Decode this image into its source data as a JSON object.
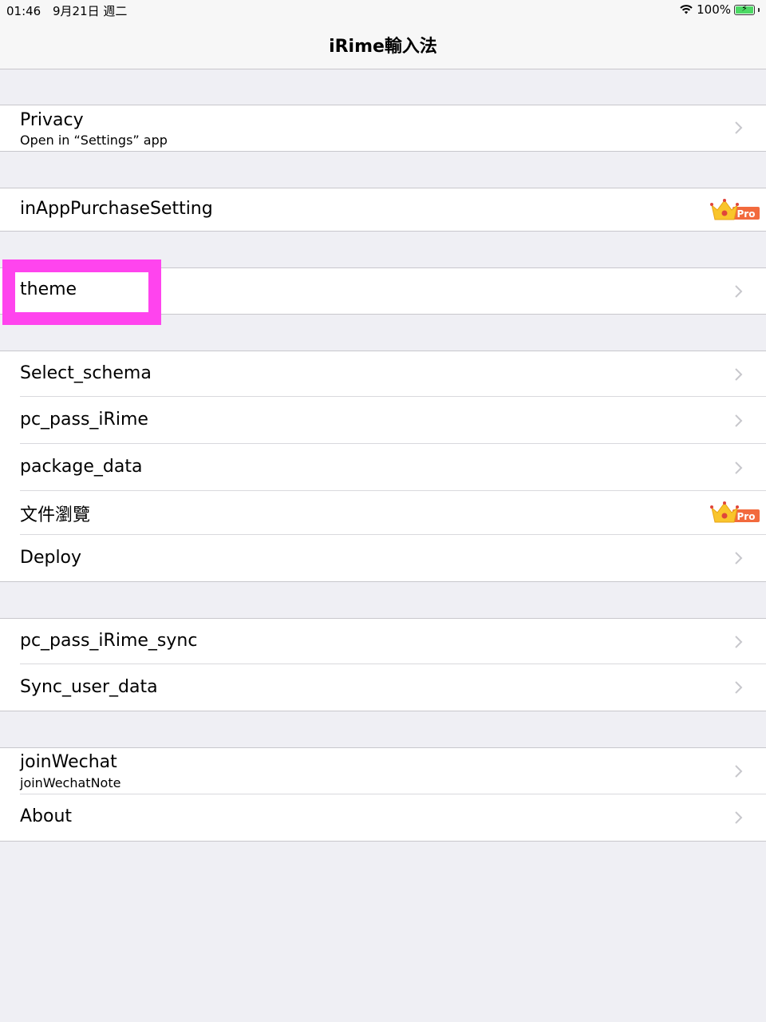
{
  "status_bar": {
    "time": "01:46",
    "date": "9月21日 週二",
    "battery_percent": "100%",
    "battery_level": 1.0
  },
  "nav": {
    "title": "iRime輸入法"
  },
  "badges": {
    "pro_label": "Pro"
  },
  "sections": [
    {
      "items": [
        {
          "title": "Privacy",
          "subtitle": "Open in “Settings” app",
          "accessory": "chevron"
        }
      ]
    },
    {
      "items": [
        {
          "title": "inAppPurchaseSetting",
          "accessory": "pro-badge"
        }
      ]
    },
    {
      "items": [
        {
          "title": "theme",
          "accessory": "chevron",
          "highlighted": true
        }
      ]
    },
    {
      "items": [
        {
          "title": "Select_schema",
          "accessory": "chevron"
        },
        {
          "title": "pc_pass_iRime",
          "accessory": "chevron"
        },
        {
          "title": "package_data",
          "accessory": "chevron"
        },
        {
          "title": "文件瀏覽",
          "accessory": "pro-badge"
        },
        {
          "title": "Deploy",
          "accessory": "chevron"
        }
      ]
    },
    {
      "items": [
        {
          "title": "pc_pass_iRime_sync",
          "accessory": "chevron"
        },
        {
          "title": "Sync_user_data",
          "accessory": "chevron"
        }
      ]
    },
    {
      "items": [
        {
          "title": "joinWechat",
          "subtitle": "joinWechatNote",
          "accessory": "chevron"
        },
        {
          "title": "About",
          "accessory": "chevron"
        }
      ]
    }
  ],
  "colors": {
    "background": "#efeff4",
    "highlight": "#ff44ee",
    "pro_badge": "#f26a3d",
    "crown": "#f9c52b",
    "chevron": "#c7c7cc"
  },
  "icons": {
    "wifi": "wifi-icon",
    "battery": "battery-charging-icon",
    "chevron": "chevron-right-icon",
    "crown": "crown-icon"
  }
}
